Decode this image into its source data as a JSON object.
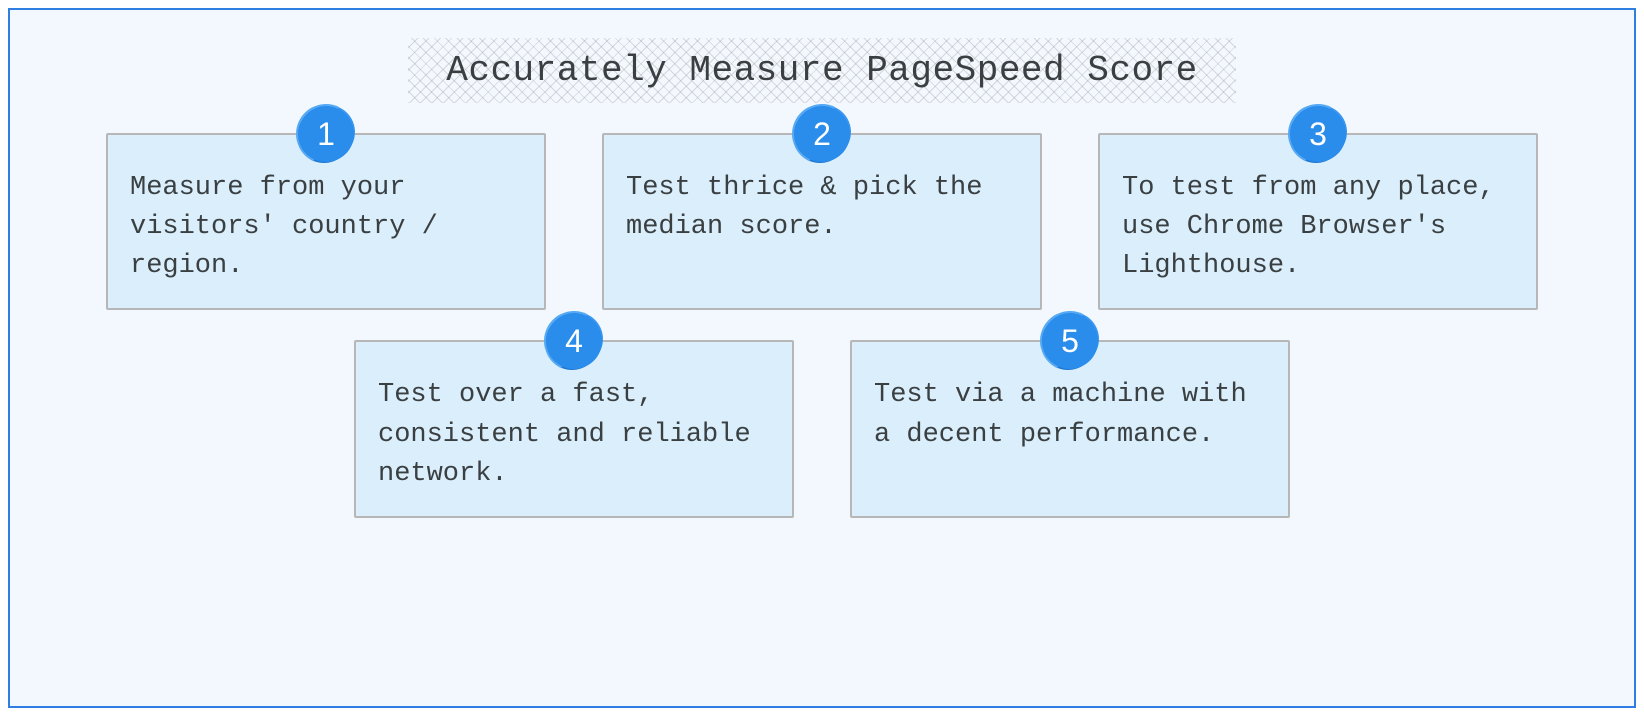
{
  "title": "Accurately Measure PageSpeed Score",
  "cards": [
    {
      "num": "1",
      "text": "Measure from your visitors' country / region."
    },
    {
      "num": "2",
      "text": "Test thrice & pick the median score."
    },
    {
      "num": "3",
      "text": "To test from any place, use Chrome Browser's Lighthouse."
    },
    {
      "num": "4",
      "text": "Test over a fast, consistent and reliable network."
    },
    {
      "num": "5",
      "text": "Test via a machine with a decent performance."
    }
  ],
  "colors": {
    "frame_border": "#2f7fe3",
    "frame_bg": "#f3f8fe",
    "card_bg": "#dbeefc",
    "card_border": "#b7b7b7",
    "badge_bg": "#2a8ceb",
    "text": "#3a4042"
  }
}
